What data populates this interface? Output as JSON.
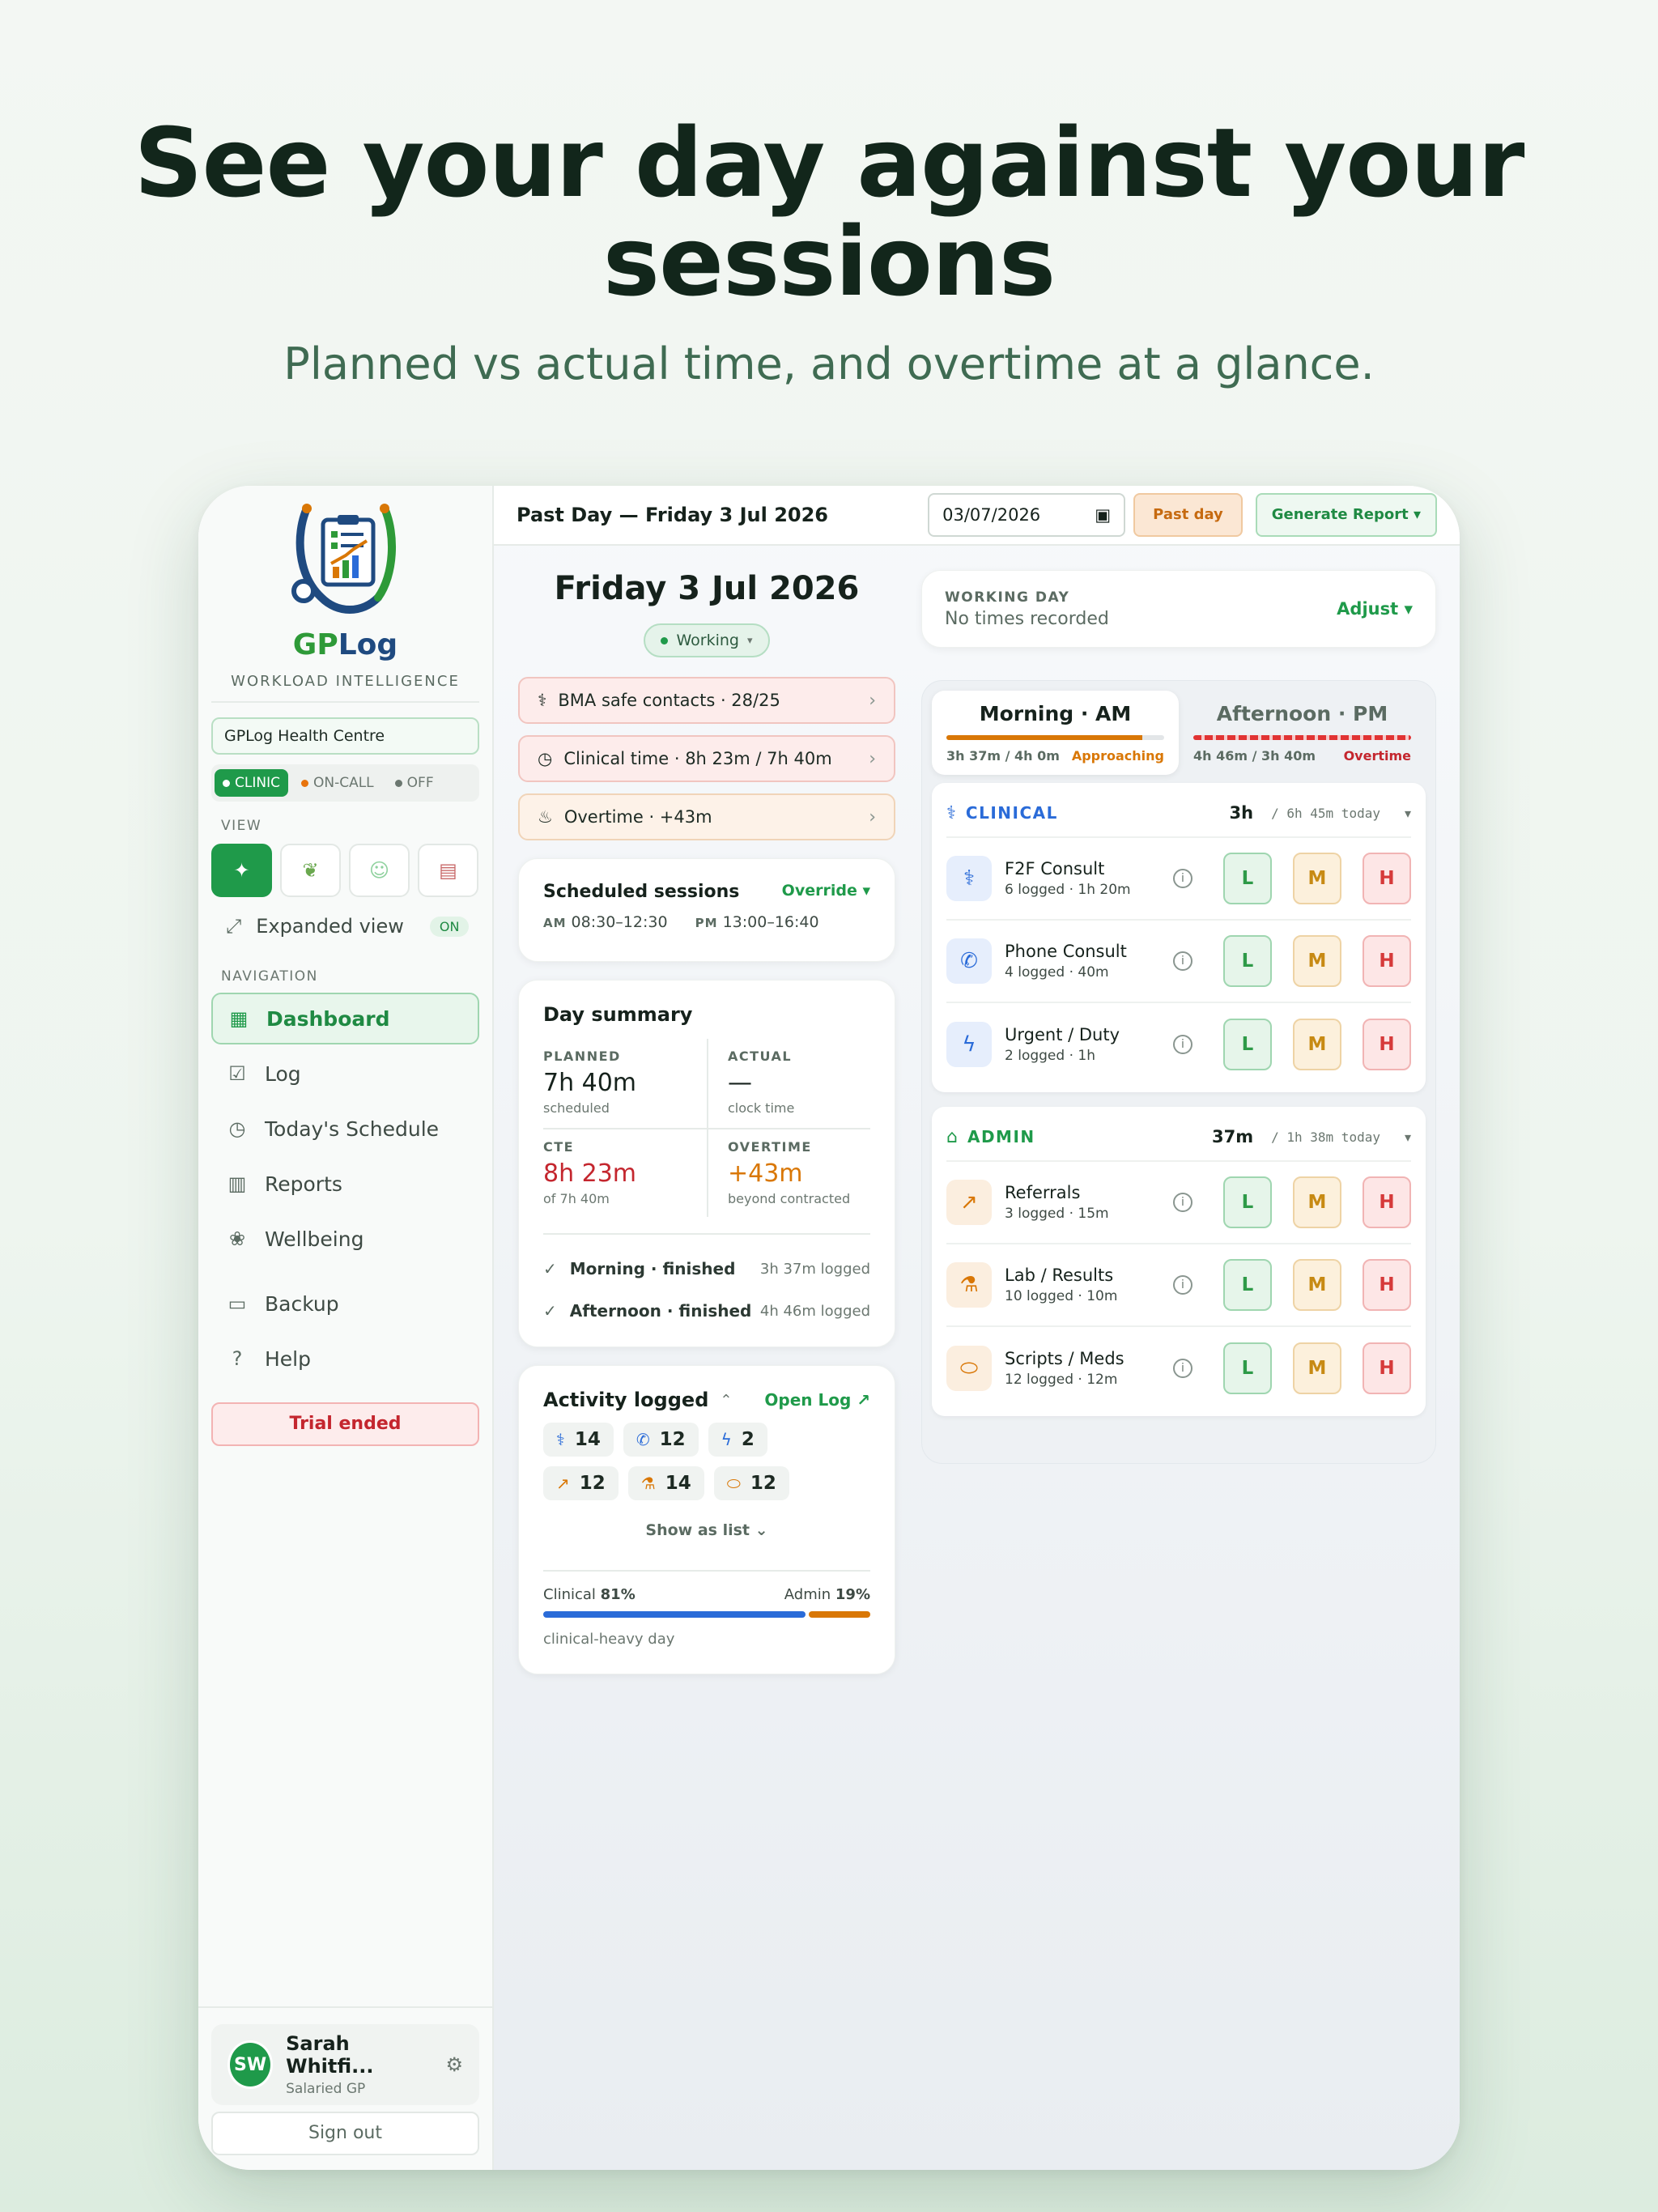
{
  "hero": {
    "title": "See your day against your sessions",
    "subtitle": "Planned vs actual time, and overtime at a glance."
  },
  "sidebar": {
    "brand_gp": "GP",
    "brand_log": "Log",
    "tagline": "WORKLOAD INTELLIGENCE",
    "practice": "GPLog Health Centre",
    "modes": [
      "CLINIC",
      "ON-CALL",
      "OFF"
    ],
    "view_label": "VIEW",
    "expanded": "Expanded view",
    "expanded_state": "ON",
    "nav_label": "NAVIGATION",
    "nav": [
      "Dashboard",
      "Log",
      "Today's Schedule",
      "Reports",
      "Wellbeing",
      "Backup",
      "Help"
    ],
    "trial": "Trial ended",
    "user": {
      "initials": "SW",
      "name": "Sarah Whitfi...",
      "role": "Salaried GP"
    },
    "signout": "Sign out"
  },
  "topbar": {
    "title": "Past Day — Friday 3 Jul 2026",
    "date_value": "03/07/2026",
    "past_day": "Past day",
    "generate": "Generate Report ▾"
  },
  "day": {
    "title": "Friday 3 Jul 2026",
    "status": "Working",
    "alerts": [
      "BMA safe contacts · 28/25",
      "Clinical time · 8h 23m / 7h 40m",
      "Overtime · +43m"
    ]
  },
  "schedule": {
    "title": "Scheduled sessions",
    "override": "Override ▾",
    "am_label": "AM",
    "am": "08:30–12:30",
    "pm_label": "PM",
    "pm": "13:00–16:40"
  },
  "summary": {
    "title": "Day summary",
    "planned_label": "PLANNED",
    "planned": "7h 40m",
    "planned_sub": "scheduled",
    "actual_label": "ACTUAL",
    "actual": "—",
    "actual_sub": "clock time",
    "cte_label": "CTE",
    "cte": "8h 23m",
    "cte_sub": "of 7h 40m",
    "overtime_label": "OVERTIME",
    "overtime": "+43m",
    "overtime_sub": "beyond contracted",
    "sessions": [
      {
        "name": "Morning · finished",
        "logged": "3h 37m logged"
      },
      {
        "name": "Afternoon · finished",
        "logged": "4h 46m logged"
      }
    ]
  },
  "activity": {
    "title": "Activity logged",
    "open": "Open Log ↗",
    "counts": [
      "14",
      "12",
      "2",
      "12",
      "14",
      "12"
    ],
    "show_list": "Show as list",
    "clinical_label": "Clinical",
    "clinical_pct": "81%",
    "admin_label": "Admin",
    "admin_pct": "19%",
    "clinical_fraction": 0.81,
    "note": "clinical-heavy day"
  },
  "working_day": {
    "label": "WORKING DAY",
    "value": "No times recorded",
    "adjust": "Adjust ▾"
  },
  "sessions_tabs": {
    "am": {
      "title": "Morning · AM",
      "stat": "3h 37m / 4h 0m",
      "status": "Approaching",
      "fill": 0.9
    },
    "pm": {
      "title": "Afternoon · PM",
      "stat": "4h 46m / 3h 40m",
      "status": "Overtime",
      "fill": 1.0
    }
  },
  "clinical": {
    "name": "CLINICAL",
    "value": "3h",
    "today": "/ 6h 45m today",
    "items": [
      {
        "name": "F2F Consult",
        "sub": "6 logged · 1h 20m"
      },
      {
        "name": "Phone Consult",
        "sub": "4 logged · 40m"
      },
      {
        "name": "Urgent / Duty",
        "sub": "2 logged · 1h"
      }
    ]
  },
  "admin": {
    "name": "ADMIN",
    "value": "37m",
    "today": "/ 1h 38m today",
    "items": [
      {
        "name": "Referrals",
        "sub": "3 logged · 15m"
      },
      {
        "name": "Lab / Results",
        "sub": "10 logged · 10m"
      },
      {
        "name": "Scripts / Meds",
        "sub": "12 logged · 12m"
      }
    ]
  },
  "lmh": [
    "L",
    "M",
    "H"
  ]
}
